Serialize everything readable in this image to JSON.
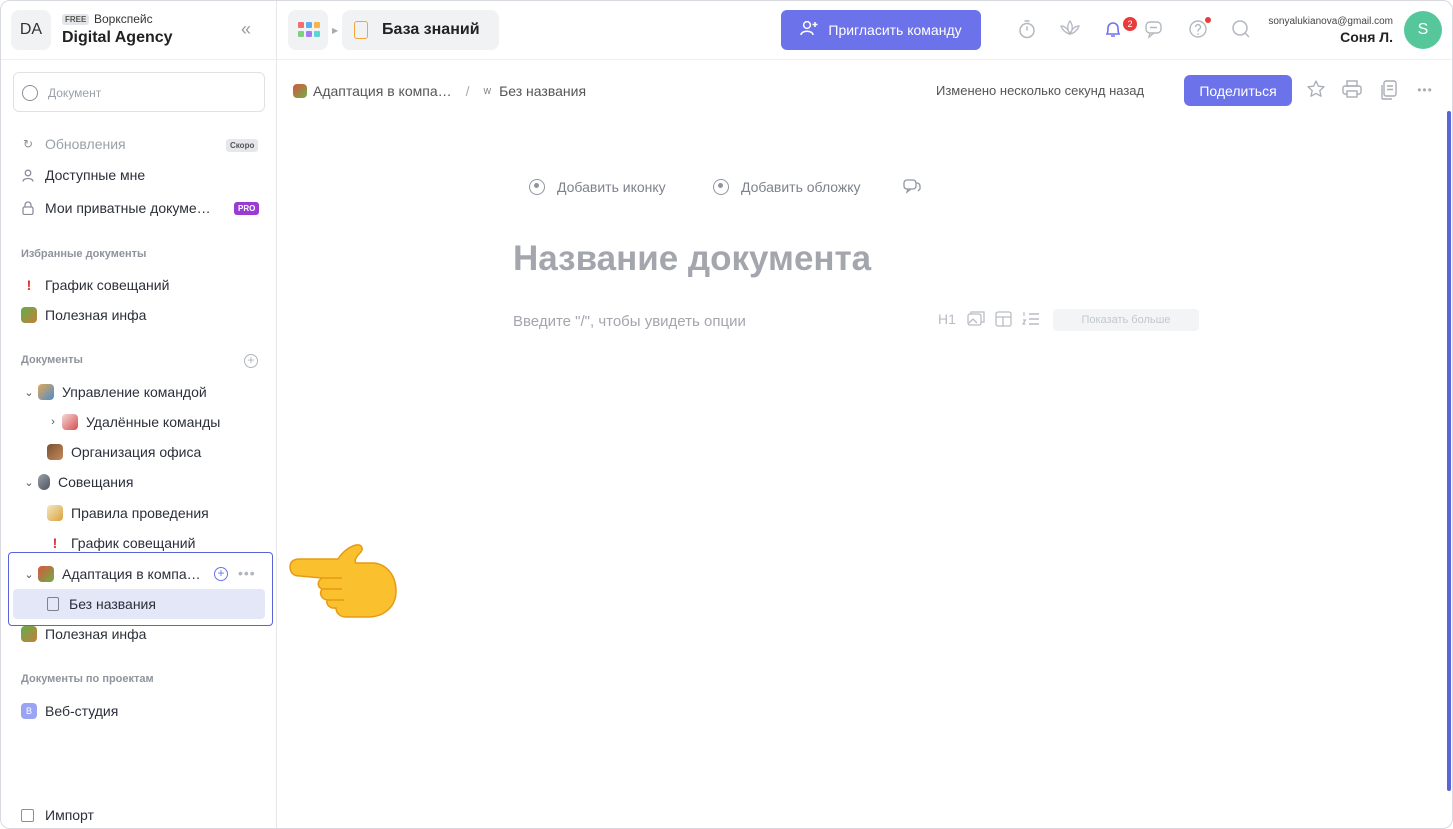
{
  "workspace": {
    "avatar_text": "DA",
    "plan_badge": "FREE",
    "label": "Воркспейс",
    "name": "Digital Agency"
  },
  "sidebar": {
    "search_placeholder": "Документ",
    "nav": [
      {
        "label": "Обновления",
        "tag": "Скоро"
      },
      {
        "label": "Доступные мне"
      },
      {
        "label": "Мои приватные докуме…",
        "tag": "PRO"
      }
    ],
    "favorites_title": "Избранные документы",
    "favorites": [
      {
        "label": "График совещаний"
      },
      {
        "label": "Полезная инфа"
      }
    ],
    "documents_title": "Документы",
    "documents": [
      {
        "label": "Управление командой"
      },
      {
        "label": "Удалённые команды"
      },
      {
        "label": "Организация офиса"
      },
      {
        "label": "Совещания"
      },
      {
        "label": "Правила проведения"
      },
      {
        "label": "График совещаний"
      },
      {
        "label": "Адаптация в компа…"
      },
      {
        "label": "Без названия"
      },
      {
        "label": "Полезная инфа"
      }
    ],
    "projects_title": "Документы по проектам",
    "projects": [
      {
        "badge": "В",
        "label": "Веб-студия"
      }
    ],
    "import_label": "Импорт"
  },
  "topbar": {
    "section_title": "База знаний",
    "invite_label": "Пригласить команду",
    "notifications_count": "2",
    "user_email": "sonyalukianova@gmail.com",
    "user_name": "Соня Л.",
    "user_avatar": "S"
  },
  "doc_header": {
    "breadcrumb_parent": "Адаптация в компа…",
    "breadcrumb_separator": "/",
    "breadcrumb_current_icon": "W",
    "breadcrumb_current": "Без названия",
    "modified_text": "Изменено несколько секунд назад",
    "share_label": "Поделиться"
  },
  "editor": {
    "add_icon_label": "Добавить иконку",
    "add_cover_label": "Добавить обложку",
    "title_placeholder": "Название документа",
    "body_placeholder": "Введите \"/\", чтобы увидеть опции",
    "heading_tool": "H1",
    "show_more_label": "Показать больше"
  },
  "colors": {
    "accent": "#6b72ea",
    "highlight_border": "#5a63d8",
    "avatar_green": "#56c79a",
    "pro_purple": "#9b3bd6",
    "badge_red": "#ea3b3b"
  }
}
